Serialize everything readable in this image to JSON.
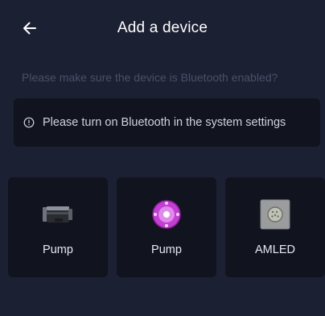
{
  "header": {
    "title": "Add a device",
    "back_icon": "arrow-left-icon"
  },
  "hint": "Please make sure the device is Bluetooth enabled?",
  "banner": {
    "icon": "info-icon",
    "text": "Please turn on Bluetooth in the system settings"
  },
  "devices": [
    {
      "label": "Pump",
      "image": "pump-cylinder-image"
    },
    {
      "label": "Pump",
      "image": "pump-round-magenta-image"
    },
    {
      "label": "AMLED",
      "image": "led-light-image"
    }
  ],
  "colors": {
    "background": "#1b2033",
    "card": "#11141f",
    "hint_text": "#4a5066",
    "accent_magenta": "#c23fd1"
  }
}
